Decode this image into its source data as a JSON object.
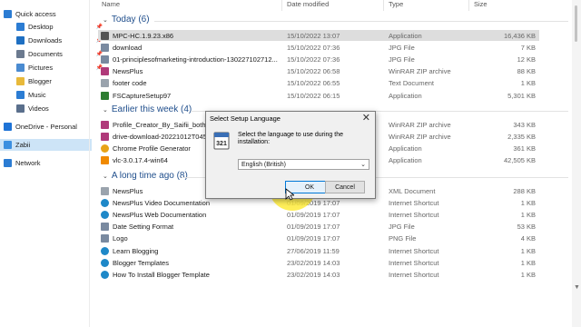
{
  "sidebar": {
    "items": [
      {
        "label": "Quick access",
        "icon": "star-icon",
        "color": "#2b7cd3",
        "pinned": false
      },
      {
        "label": "Desktop",
        "icon": "desktop-icon",
        "color": "#2b7cd3",
        "pinned": true
      },
      {
        "label": "Downloads",
        "icon": "download-icon",
        "color": "#1e6fc2",
        "pinned": true
      },
      {
        "label": "Documents",
        "icon": "document-icon",
        "color": "#6b7a8f",
        "pinned": true
      },
      {
        "label": "Pictures",
        "icon": "picture-icon",
        "color": "#4a8bd1",
        "pinned": true
      },
      {
        "label": "Blogger",
        "icon": "folder-icon",
        "color": "#e8b93a",
        "pinned": false
      },
      {
        "label": "Music",
        "icon": "music-icon",
        "color": "#2b7cd3",
        "pinned": false
      },
      {
        "label": "Videos",
        "icon": "video-icon",
        "color": "#5a6f8c",
        "pinned": false
      },
      {
        "label": "OneDrive - Personal",
        "icon": "cloud-icon",
        "color": "#1e73d6",
        "pinned": false
      },
      {
        "label": "Zabii",
        "icon": "computer-icon",
        "color": "#3b8fe0",
        "pinned": false,
        "selected": true
      },
      {
        "label": "Network",
        "icon": "network-icon",
        "color": "#2b7cd3",
        "pinned": false
      }
    ]
  },
  "columns": {
    "name": "Name",
    "date": "Date modified",
    "type": "Type",
    "size": "Size"
  },
  "groups": [
    {
      "label": "Today (6)",
      "rows": [
        {
          "name": "MPC-HC.1.9.23.x86",
          "date": "15/10/2022 13:07",
          "type": "Application",
          "size": "16,436 KB",
          "icon": "app-icon",
          "color": "#555555",
          "selected": true
        },
        {
          "name": "download",
          "date": "15/10/2022 07:36",
          "type": "JPG File",
          "size": "7 KB",
          "icon": "image-file-icon",
          "color": "#7a8aa0"
        },
        {
          "name": "01-principlesofmarketing-introduction-130227102712...",
          "date": "15/10/2022 07:36",
          "type": "JPG File",
          "size": "12 KB",
          "icon": "image-file-icon",
          "color": "#7a8aa0"
        },
        {
          "name": "NewsPlus",
          "date": "15/10/2022 06:58",
          "type": "WinRAR ZIP archive",
          "size": "88 KB",
          "icon": "archive-icon",
          "color": "#b03a7a"
        },
        {
          "name": "footer code",
          "date": "15/10/2022 06:55",
          "type": "Text Document",
          "size": "1 KB",
          "icon": "text-file-icon",
          "color": "#9aa3ad"
        },
        {
          "name": "FSCaptureSetup97",
          "date": "15/10/2022 06:15",
          "type": "Application",
          "size": "5,301 KB",
          "icon": "installer-icon",
          "color": "#2e7d32"
        }
      ]
    },
    {
      "label": "Earlier this week (4)",
      "rows": [
        {
          "name": "Profile_Creator_By_Saifii_both_",
          "date": "",
          "type": "WinRAR ZIP archive",
          "size": "343 KB",
          "icon": "archive-icon",
          "color": "#b03a7a"
        },
        {
          "name": "drive-download-20221012T045",
          "date": "",
          "type": "WinRAR ZIP archive",
          "size": "2,335 KB",
          "icon": "archive-icon",
          "color": "#b03a7a"
        },
        {
          "name": "Chrome Profile Generator",
          "date": "",
          "type": "Application",
          "size": "361 KB",
          "icon": "chrome-icon",
          "color": "#e8a317"
        },
        {
          "name": "vlc-3.0.17.4-win64",
          "date": "",
          "type": "Application",
          "size": "42,505 KB",
          "icon": "vlc-icon",
          "color": "#f08a00"
        }
      ]
    },
    {
      "label": "A long time ago (8)",
      "rows": [
        {
          "name": "NewsPlus",
          "date": "",
          "type": "XML Document",
          "size": "288 KB",
          "icon": "xml-file-icon",
          "color": "#9aa3ad"
        },
        {
          "name": "NewsPlus Video Documentation",
          "date": "01/09/2019 17:07",
          "type": "Internet Shortcut",
          "size": "1 KB",
          "icon": "edge-icon",
          "color": "#1e88c8"
        },
        {
          "name": "NewsPlus Web Documentation",
          "date": "01/09/2019 17:07",
          "type": "Internet Shortcut",
          "size": "1 KB",
          "icon": "edge-icon",
          "color": "#1e88c8"
        },
        {
          "name": "Date Setting Format",
          "date": "01/09/2019 17:07",
          "type": "JPG File",
          "size": "53 KB",
          "icon": "image-file-icon",
          "color": "#7a8aa0"
        },
        {
          "name": "Logo",
          "date": "01/09/2019 17:07",
          "type": "PNG File",
          "size": "4 KB",
          "icon": "image-file-icon",
          "color": "#7a8aa0"
        },
        {
          "name": "Learn Blogging",
          "date": "27/06/2019 11:59",
          "type": "Internet Shortcut",
          "size": "1 KB",
          "icon": "edge-icon",
          "color": "#1e88c8"
        },
        {
          "name": "Blogger Templates",
          "date": "23/02/2019 14:03",
          "type": "Internet Shortcut",
          "size": "1 KB",
          "icon": "edge-icon",
          "color": "#1e88c8"
        },
        {
          "name": "How To Install Blogger Template",
          "date": "23/02/2019 14:03",
          "type": "Internet Shortcut",
          "size": "1 KB",
          "icon": "edge-icon",
          "color": "#1e88c8"
        }
      ]
    }
  ],
  "dialog": {
    "title": "Select Setup Language",
    "close": "✕",
    "message": "Select the language to use during the installation:",
    "language_value": "English (British)",
    "ok_label": "OK",
    "cancel_label": "Cancel",
    "icon": "setup-language-icon"
  },
  "colors": {
    "group_header": "#1f4e8c",
    "selection": "#cde4f7",
    "highlight": "#ffec3c"
  }
}
